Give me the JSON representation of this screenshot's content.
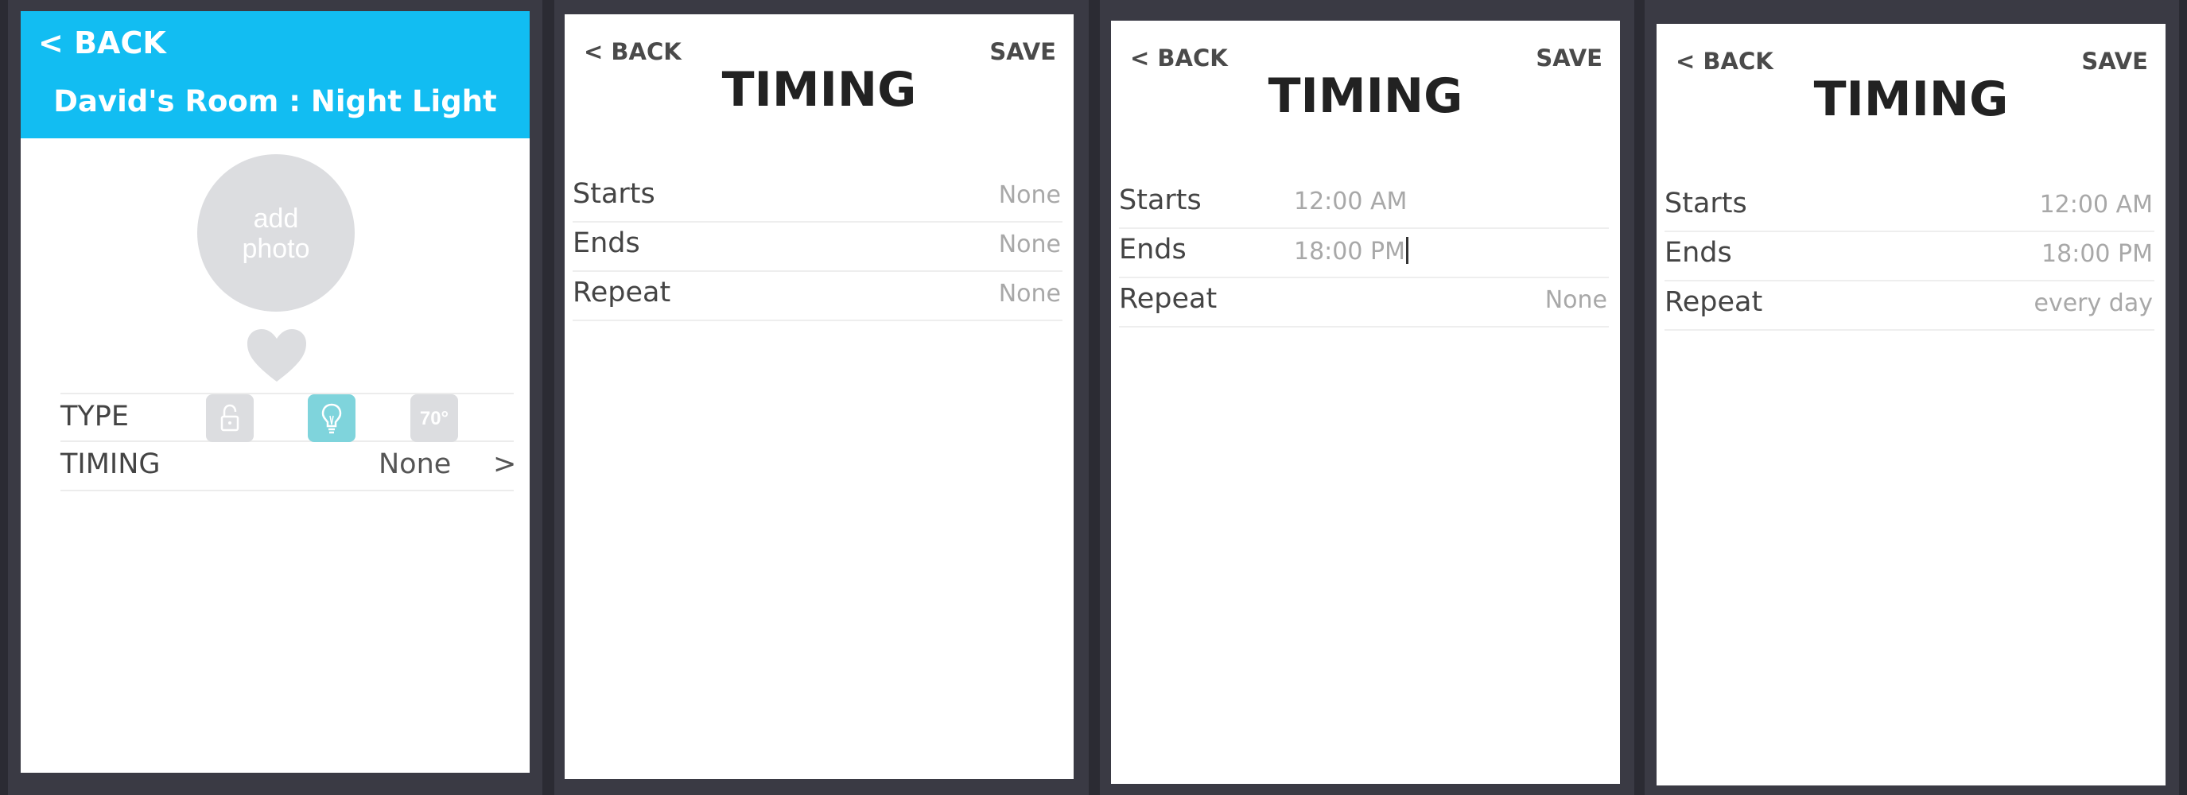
{
  "screen1": {
    "back_label": "< BACK",
    "title": "David's Room : Night Light",
    "photo_label_line1": "add",
    "photo_label_line2": "photo",
    "type_label": "TYPE",
    "temp_icon_text": "70°",
    "timing_label": "TIMING",
    "timing_value": "None",
    "timing_chevron": ">"
  },
  "screen2": {
    "back_label": "< BACK",
    "save_label": "SAVE",
    "title": "TIMING",
    "rows": [
      {
        "label": "Starts",
        "value": "None"
      },
      {
        "label": "Ends",
        "value": "None"
      },
      {
        "label": "Repeat",
        "value": "None"
      }
    ]
  },
  "screen3": {
    "back_label": "< BACK",
    "save_label": "SAVE",
    "title": "TIMING",
    "rows": [
      {
        "label": "Starts",
        "value": "12:00 AM"
      },
      {
        "label": "Ends",
        "value": "18:00 PM"
      },
      {
        "label": "Repeat",
        "value": "None"
      }
    ]
  },
  "screen4": {
    "back_label": "< BACK",
    "save_label": "SAVE",
    "title": "TIMING",
    "rows": [
      {
        "label": "Starts",
        "value": "12:00 AM"
      },
      {
        "label": "Ends",
        "value": "18:00 PM"
      },
      {
        "label": "Repeat",
        "value": "every day"
      }
    ]
  },
  "colors": {
    "header_blue": "#12bdf2",
    "active_type": "#7fd4dc",
    "inactive_type": "#dcdde0"
  }
}
